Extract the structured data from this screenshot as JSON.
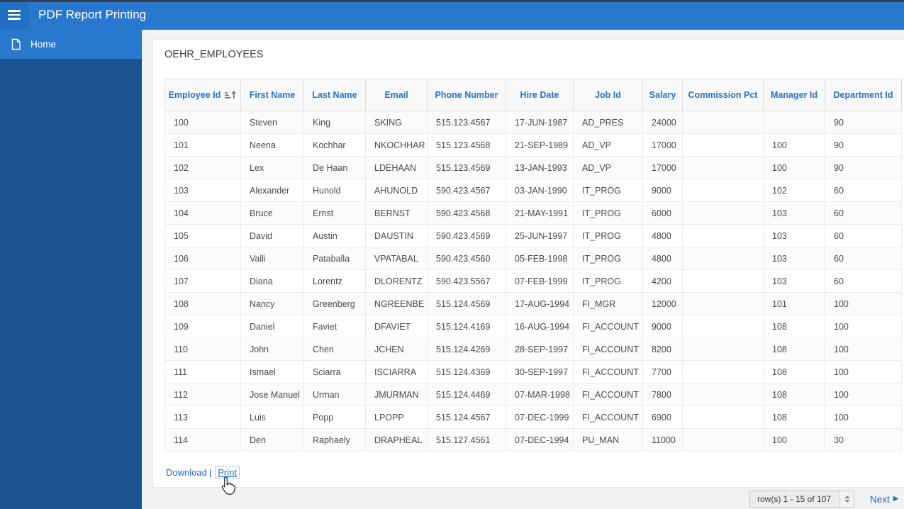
{
  "top_bar": {
    "title": "PDF Report Printing"
  },
  "sidebar": {
    "items": [
      {
        "label": "Home"
      }
    ]
  },
  "report": {
    "title": "OEHR_EMPLOYEES",
    "table": {
      "columns": [
        "Employee Id",
        "First Name",
        "Last Name",
        "Email",
        "Phone Number",
        "Hire Date",
        "Job Id",
        "Salary",
        "Commission Pct",
        "Manager Id",
        "Department Id"
      ],
      "sort": {
        "column": "Employee Id",
        "direction": "ascending"
      },
      "rows": [
        [
          "100",
          "Steven",
          "King",
          "SKING",
          "515.123.4567",
          "17-JUN-1987",
          "AD_PRES",
          "24000",
          "",
          "",
          "90"
        ],
        [
          "101",
          "Neena",
          "Kochhar",
          "NKOCHHAR",
          "515.123.4568",
          "21-SEP-1989",
          "AD_VP",
          "17000",
          "",
          "100",
          "90"
        ],
        [
          "102",
          "Lex",
          "De Haan",
          "LDEHAAN",
          "515.123.4569",
          "13-JAN-1993",
          "AD_VP",
          "17000",
          "",
          "100",
          "90"
        ],
        [
          "103",
          "Alexander",
          "Hunold",
          "AHUNOLD",
          "590.423.4567",
          "03-JAN-1990",
          "IT_PROG",
          "9000",
          "",
          "102",
          "60"
        ],
        [
          "104",
          "Bruce",
          "Ernst",
          "BERNST",
          "590.423.4568",
          "21-MAY-1991",
          "IT_PROG",
          "6000",
          "",
          "103",
          "60"
        ],
        [
          "105",
          "David",
          "Austin",
          "DAUSTIN",
          "590.423.4569",
          "25-JUN-1997",
          "IT_PROG",
          "4800",
          "",
          "103",
          "60"
        ],
        [
          "106",
          "Valli",
          "Pataballa",
          "VPATABAL",
          "590.423.4560",
          "05-FEB-1998",
          "IT_PROG",
          "4800",
          "",
          "103",
          "60"
        ],
        [
          "107",
          "Diana",
          "Lorentz",
          "DLORENTZ",
          "590.423.5567",
          "07-FEB-1999",
          "IT_PROG",
          "4200",
          "",
          "103",
          "60"
        ],
        [
          "108",
          "Nancy",
          "Greenberg",
          "NGREENBE",
          "515.124.4569",
          "17-AUG-1994",
          "FI_MGR",
          "12000",
          "",
          "101",
          "100"
        ],
        [
          "109",
          "Daniel",
          "Faviet",
          "DFAVIET",
          "515.124.4169",
          "16-AUG-1994",
          "FI_ACCOUNT",
          "9000",
          "",
          "108",
          "100"
        ],
        [
          "110",
          "John",
          "Chen",
          "JCHEN",
          "515.124.4269",
          "28-SEP-1997",
          "FI_ACCOUNT",
          "8200",
          "",
          "108",
          "100"
        ],
        [
          "111",
          "Ismael",
          "Sciarra",
          "ISCIARRA",
          "515.124.4369",
          "30-SEP-1997",
          "FI_ACCOUNT",
          "7700",
          "",
          "108",
          "100"
        ],
        [
          "112",
          "Jose Manuel",
          "Urman",
          "JMURMAN",
          "515.124.4469",
          "07-MAR-1998",
          "FI_ACCOUNT",
          "7800",
          "",
          "108",
          "100"
        ],
        [
          "113",
          "Luis",
          "Popp",
          "LPOPP",
          "515.124.4567",
          "07-DEC-1999",
          "FI_ACCOUNT",
          "6900",
          "",
          "108",
          "100"
        ],
        [
          "114",
          "Den",
          "Raphaely",
          "DRAPHEAL",
          "515.127.4561",
          "07-DEC-1994",
          "PU_MAN",
          "11000",
          "",
          "100",
          "30"
        ]
      ]
    },
    "actions": {
      "download": "Download",
      "separator": "|",
      "print": "Print"
    },
    "pagination": {
      "range_label": "row(s) 1 - 15 of 107",
      "next_label": "Next",
      "next_arrow": "▶"
    }
  },
  "colors": {
    "header_blue": "#2878cd",
    "menu_button_blue": "#2070c3",
    "sidebar_blue": "#1a5390",
    "link_blue": "#1b6cc2",
    "column_header_text": "#1d76c9"
  }
}
